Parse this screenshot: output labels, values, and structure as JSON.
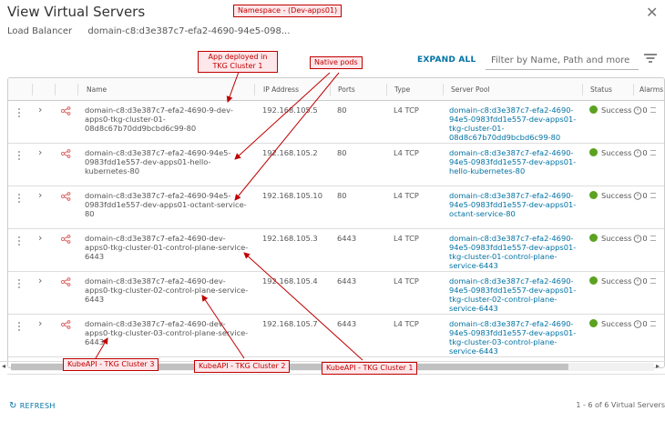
{
  "dialog": {
    "title": "View Virtual Servers",
    "close_icon": "close-icon",
    "load_balancer_label": "Load Balancer",
    "load_balancer_value": "domain-c8:d3e387c7-efa2-4690-94e5-098..."
  },
  "toolbar": {
    "expand_all_label": "EXPAND ALL",
    "filter_placeholder": "Filter by Name, Path and more",
    "filter_icon": "filter-icon"
  },
  "columns": {
    "name": "Name",
    "ip": "IP Address",
    "ports": "Ports",
    "type": "Type",
    "pool": "Server Pool",
    "status": "Status",
    "alarms": "Alarms"
  },
  "rows": [
    {
      "name": "domain-c8:d3e387c7-efa2-4690-9-dev-apps0-tkg-cluster-01-08d8c67b70dd9bcbd6c99-80",
      "ip": "192.168.105.5",
      "ports": "80",
      "type": "L4 TCP",
      "pool": "domain-c8:d3e387c7-efa2-4690-94e5-0983fdd1e557-dev-apps01-tkg-cluster-01-08d8c67b70dd9bcbd6c99-80",
      "status": "Success",
      "alarms": "0"
    },
    {
      "name": "domain-c8:d3e387c7-efa2-4690-94e5-0983fdd1e557-dev-apps01-hello-kubernetes-80",
      "ip": "192.168.105.2",
      "ports": "80",
      "type": "L4 TCP",
      "pool": "domain-c8:d3e387c7-efa2-4690-94e5-0983fdd1e557-dev-apps01-hello-kubernetes-80",
      "status": "Success",
      "alarms": "0"
    },
    {
      "name": "domain-c8:d3e387c7-efa2-4690-94e5-0983fdd1e557-dev-apps01-octant-service-80",
      "ip": "192.168.105.10",
      "ports": "80",
      "type": "L4 TCP",
      "pool": "domain-c8:d3e387c7-efa2-4690-94e5-0983fdd1e557-dev-apps01-octant-service-80",
      "status": "Success",
      "alarms": "0"
    },
    {
      "name": "domain-c8:d3e387c7-efa2-4690-dev-apps0-tkg-cluster-01-control-plane-service-6443",
      "ip": "192.168.105.3",
      "ports": "6443",
      "type": "L4 TCP",
      "pool": "domain-c8:d3e387c7-efa2-4690-94e5-0983fdd1e557-dev-apps01-tkg-cluster-01-control-plane-service-6443",
      "status": "Success",
      "alarms": "0"
    },
    {
      "name": "domain-c8:d3e387c7-efa2-4690-dev-apps0-tkg-cluster-02-control-plane-service-6443",
      "ip": "192.168.105.4",
      "ports": "6443",
      "type": "L4 TCP",
      "pool": "domain-c8:d3e387c7-efa2-4690-94e5-0983fdd1e557-dev-apps01-tkg-cluster-02-control-plane-service-6443",
      "status": "Success",
      "alarms": "0"
    },
    {
      "name": "domain-c8:d3e387c7-efa2-4690-dev-apps0-tkg-cluster-03-control-plane-service-6443",
      "ip": "192.168.105.7",
      "ports": "6443",
      "type": "L4 TCP",
      "pool": "domain-c8:d3e387c7-efa2-4690-94e5-0983fdd1e557-dev-apps01-tkg-cluster-03-control-plane-service-6443",
      "status": "Success",
      "alarms": "0"
    }
  ],
  "footer": {
    "refresh_label": "REFRESH",
    "page_count": "1 - 6 of 6 Virtual Servers"
  },
  "annotations": {
    "namespace": "Namespace - (Dev-apps01)",
    "tkg_app": "App deployed in TKG Cluster 1",
    "native_pods": "Native pods",
    "kubeapi_3": "KubeAPI - TKG Cluster 3",
    "kubeapi_2": "KubeAPI - TKG Cluster 2",
    "kubeapi_1": "KubeAPI - TKG Cluster 1"
  },
  "colors": {
    "link": "#0072a3",
    "success": "#5aa220",
    "annotation_border": "#c00000",
    "annotation_fill": "#fde7ea"
  }
}
